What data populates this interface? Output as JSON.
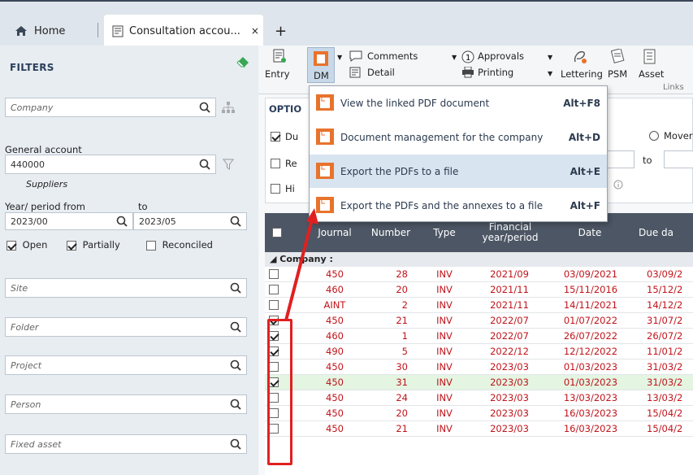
{
  "tabs": {
    "home": "Home",
    "active": "Consultation accou...",
    "close": "×",
    "plus": "+"
  },
  "filters": {
    "title": "FILTERS",
    "company_ph": "Company",
    "general_account_label": "General account",
    "general_account_value": "440000",
    "suppliers": "Suppliers",
    "year_from_label": "Year/ period from",
    "to_label": "to",
    "year_from": "2023/00",
    "year_to": "2023/05",
    "open": "Open",
    "partially": "Partially",
    "reconciled": "Reconciled",
    "site": "Site",
    "folder": "Folder",
    "project": "Project",
    "person": "Person",
    "fixed_asset": "Fixed asset"
  },
  "toolbar": {
    "entry": "Entry",
    "dm": "DM",
    "comments": "Comments",
    "detail": "Detail",
    "approvals": "Approvals",
    "printing": "Printing",
    "lettering": "Lettering",
    "psm": "PSM",
    "asset": "Asset",
    "links": "Links"
  },
  "options": {
    "title": "OPTIO",
    "du": "Du",
    "re": "Re",
    "hi": "Hi",
    "mover": "Mover",
    "to": "to"
  },
  "menu": [
    {
      "label": "View the linked PDF document",
      "key": "Alt+F8"
    },
    {
      "label": "Document management for the company",
      "key": "Alt+D"
    },
    {
      "label": "Export the PDFs to a file",
      "key": "Alt+E"
    },
    {
      "label": "Export the PDFs and the annexes to a file",
      "key": "Alt+F"
    }
  ],
  "grid": {
    "headers": [
      "Journal",
      "Number",
      "Type",
      "Financial year/period",
      "Date",
      "Due da"
    ],
    "group": "◢ Company :",
    "rows": [
      {
        "checked": false,
        "journal": "450",
        "number": "28",
        "type": "INV",
        "period": "2021/09",
        "date": "03/09/2021",
        "due": "03/09/2"
      },
      {
        "checked": false,
        "journal": "460",
        "number": "20",
        "type": "INV",
        "period": "2021/11",
        "date": "15/11/2016",
        "due": "15/12/2"
      },
      {
        "checked": false,
        "journal": "AINT",
        "number": "2",
        "type": "INV",
        "period": "2021/11",
        "date": "14/11/2021",
        "due": "14/12/2"
      },
      {
        "checked": true,
        "journal": "450",
        "number": "21",
        "type": "INV",
        "period": "2022/07",
        "date": "01/07/2022",
        "due": "31/07/2"
      },
      {
        "checked": true,
        "journal": "460",
        "number": "1",
        "type": "INV",
        "period": "2022/07",
        "date": "26/07/2022",
        "due": "26/07/2"
      },
      {
        "checked": true,
        "journal": "490",
        "number": "5",
        "type": "INV",
        "period": "2022/12",
        "date": "12/12/2022",
        "due": "11/01/2"
      },
      {
        "checked": false,
        "journal": "450",
        "number": "30",
        "type": "INV",
        "period": "2023/03",
        "date": "01/03/2023",
        "due": "31/03/2"
      },
      {
        "checked": true,
        "journal": "450",
        "number": "31",
        "type": "INV",
        "period": "2023/03",
        "date": "01/03/2023",
        "due": "31/03/2"
      },
      {
        "checked": false,
        "journal": "450",
        "number": "24",
        "type": "INV",
        "period": "2023/03",
        "date": "13/03/2023",
        "due": "13/03/2"
      },
      {
        "checked": false,
        "journal": "450",
        "number": "20",
        "type": "INV",
        "period": "2023/03",
        "date": "16/03/2023",
        "due": "15/04/2"
      },
      {
        "checked": false,
        "journal": "450",
        "number": "21",
        "type": "INV",
        "period": "2023/03",
        "date": "16/03/2023",
        "due": "15/04/2"
      }
    ]
  },
  "colors": {
    "accent_orange": "#e8732c",
    "red_text": "#c0141b",
    "annotation_red": "#e02020",
    "header_bg": "#4c5664"
  }
}
